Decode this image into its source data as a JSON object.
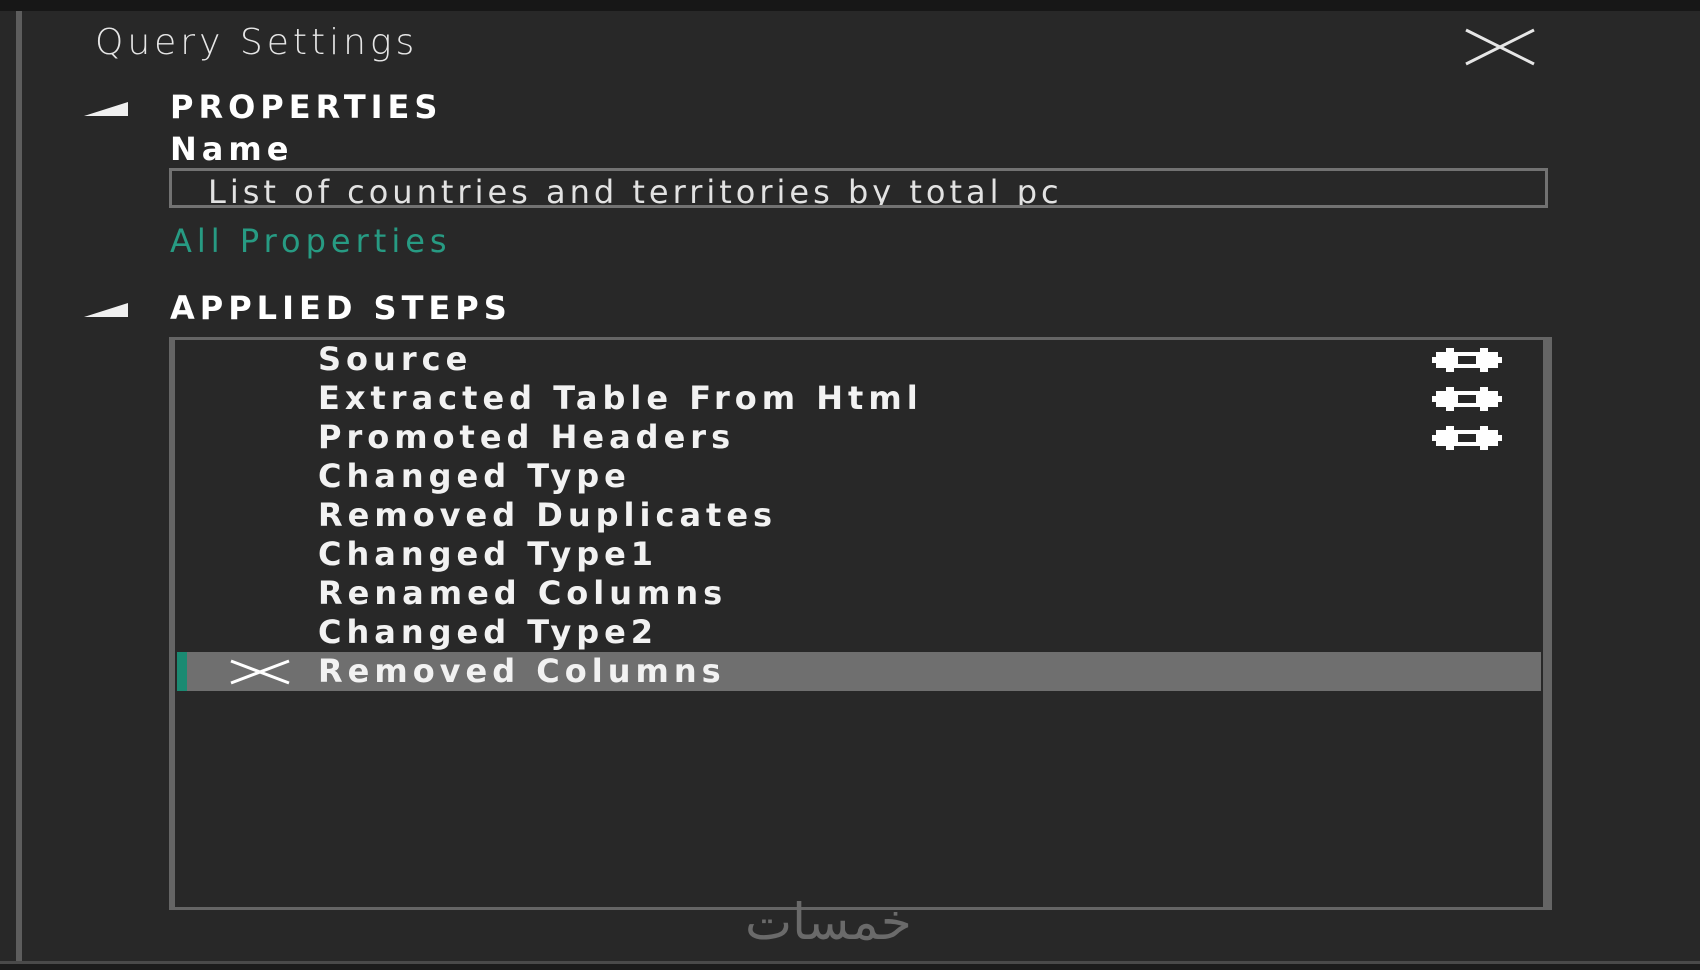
{
  "panel": {
    "title": "Query Settings"
  },
  "properties": {
    "header": "PROPERTIES",
    "name_label": "Name",
    "name_value": "List of countries and territories by total pc",
    "all_properties_link": "All Properties"
  },
  "applied_steps": {
    "header": "APPLIED STEPS",
    "steps": [
      {
        "label": "Source",
        "has_settings": true,
        "selected": false
      },
      {
        "label": "Extracted Table From Html",
        "has_settings": true,
        "selected": false
      },
      {
        "label": "Promoted Headers",
        "has_settings": true,
        "selected": false
      },
      {
        "label": "Changed Type",
        "has_settings": false,
        "selected": false
      },
      {
        "label": "Removed Duplicates",
        "has_settings": false,
        "selected": false
      },
      {
        "label": "Changed Type1",
        "has_settings": false,
        "selected": false
      },
      {
        "label": "Renamed Columns",
        "has_settings": false,
        "selected": false
      },
      {
        "label": "Changed Type2",
        "has_settings": false,
        "selected": false
      },
      {
        "label": "Removed Columns",
        "has_settings": false,
        "selected": true
      }
    ]
  },
  "watermark": {
    "text": "خمسات"
  },
  "icons": {
    "close": "close-icon",
    "collapse": "collapse-triangle-icon",
    "settings": "gear-icon",
    "delete": "delete-x-icon"
  },
  "colors": {
    "background": "#282828",
    "link": "#279b83",
    "selected_row": "#6f6f6f",
    "selection_accent": "#1a8a72"
  }
}
